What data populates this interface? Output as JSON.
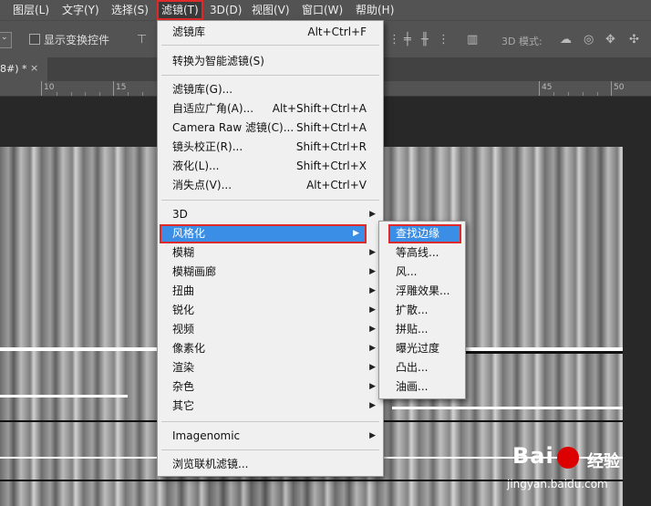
{
  "menubar": {
    "items": [
      "图层(L)",
      "文字(Y)",
      "选择(S)",
      "滤镜(T)",
      "3D(D)",
      "视图(V)",
      "窗口(W)",
      "帮助(H)"
    ]
  },
  "options": {
    "show_transform_controls": "显示变换控件",
    "mode_3d": "3D 模式:"
  },
  "tab": {
    "title": "8#) *",
    "close": "×"
  },
  "ruler": {
    "ticks": [
      "10",
      "15",
      "45",
      "50"
    ]
  },
  "filter_menu": {
    "items": [
      {
        "label": "滤镜库",
        "shortcut": "Alt+Ctrl+F"
      },
      {
        "label": "转换为智能滤镜(S)",
        "shortcut": ""
      },
      {
        "label": "滤镜库(G)...",
        "shortcut": ""
      },
      {
        "label": "自适应广角(A)...",
        "shortcut": "Alt+Shift+Ctrl+A"
      },
      {
        "label": "Camera Raw 滤镜(C)...",
        "shortcut": "Shift+Ctrl+A"
      },
      {
        "label": "镜头校正(R)...",
        "shortcut": "Shift+Ctrl+R"
      },
      {
        "label": "液化(L)...",
        "shortcut": "Shift+Ctrl+X"
      },
      {
        "label": "消失点(V)...",
        "shortcut": "Alt+Ctrl+V"
      },
      {
        "label": "3D",
        "shortcut": ""
      },
      {
        "label": "风格化",
        "shortcut": ""
      },
      {
        "label": "模糊",
        "shortcut": ""
      },
      {
        "label": "模糊画廊",
        "shortcut": ""
      },
      {
        "label": "扭曲",
        "shortcut": ""
      },
      {
        "label": "锐化",
        "shortcut": ""
      },
      {
        "label": "视频",
        "shortcut": ""
      },
      {
        "label": "像素化",
        "shortcut": ""
      },
      {
        "label": "渲染",
        "shortcut": ""
      },
      {
        "label": "杂色",
        "shortcut": ""
      },
      {
        "label": "其它",
        "shortcut": ""
      },
      {
        "label": "Imagenomic",
        "shortcut": ""
      },
      {
        "label": "浏览联机滤镜...",
        "shortcut": ""
      }
    ]
  },
  "stylize_submenu": {
    "items": [
      "查找边缘",
      "等高线...",
      "风...",
      "浮雕效果...",
      "扩散...",
      "拼贴...",
      "曝光过度",
      "凸出...",
      "油画..."
    ]
  },
  "watermark": {
    "logo": "Bai",
    "jingyan": "经验",
    "url": "jingyan.baidu.com"
  }
}
